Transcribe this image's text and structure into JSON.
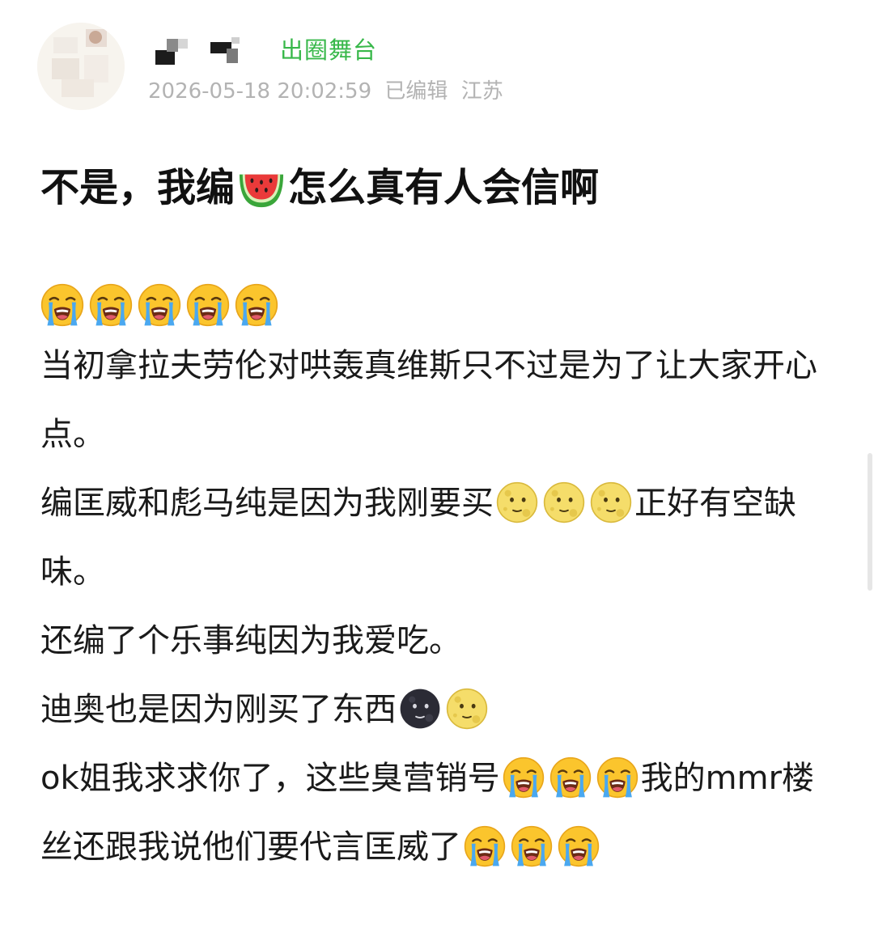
{
  "post": {
    "tag": "出圈舞台",
    "date": "2026-05-18 20:02:59",
    "edited": "已编辑",
    "location": "江苏",
    "title_before": "不是，我编",
    "title_after": "怎么真有人会信啊",
    "lines": [
      "当初拿拉夫劳伦对哄轰真维斯只不过是为了让大家开心点。",
      "编匡威和彪马纯是因为我刚要买",
      "正好有空缺味。",
      "还编了个乐事纯因为我爱吃。",
      "迪奥也是因为刚买了东西",
      "ok姐我求求你了，这些臭营销号",
      "我的mmr楼丝还跟我说他们要代言匡威了"
    ]
  },
  "icons": {
    "title_emoji": "watermelon-icon",
    "crying": "loudly-crying-face-icon",
    "moon_face": "full-moon-face-icon",
    "new_moon_face": "new-moon-face-icon"
  },
  "colors": {
    "tag": "#38b84a",
    "meta": "#b3b3b3",
    "text": "#1a1a1a"
  }
}
